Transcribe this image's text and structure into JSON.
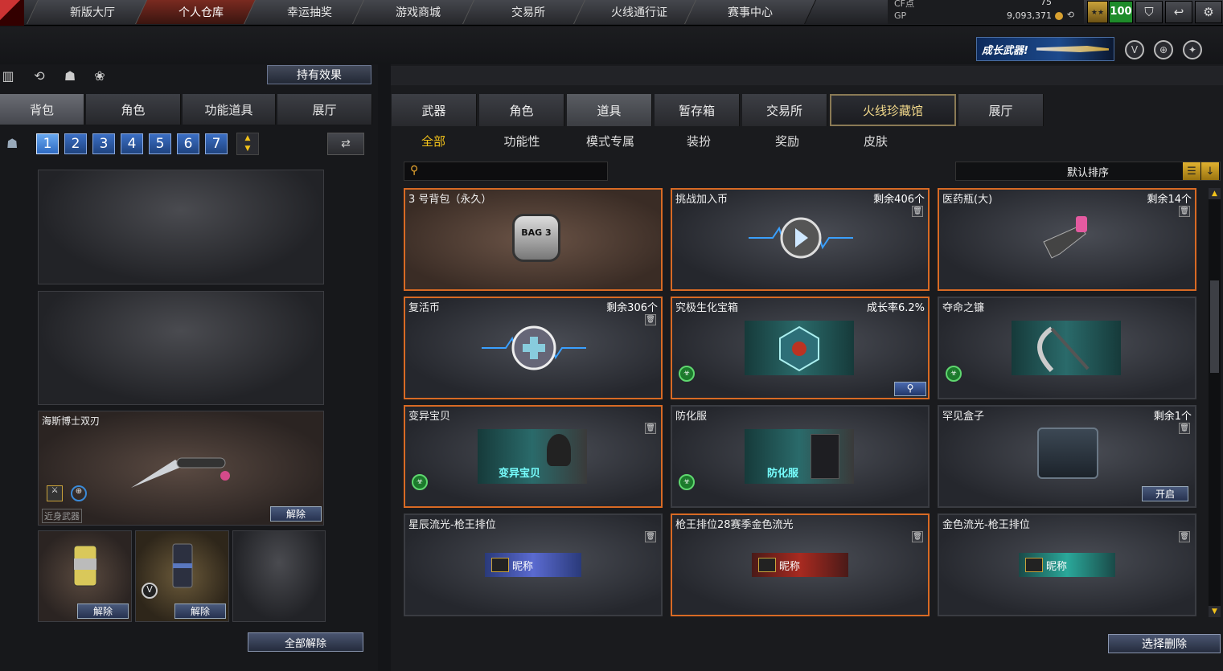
{
  "nav": {
    "tabs": [
      "新版大厅",
      "个人仓库",
      "幸运抽奖",
      "游戏商城",
      "交易所",
      "火线通行证",
      "赛事中心"
    ],
    "active": 1
  },
  "currency": {
    "cf_label": "CF点",
    "cf_value": "75",
    "gp_label": "GP",
    "gp_value": "9,093,371"
  },
  "level": "100",
  "grow_banner": "成长武器!",
  "left": {
    "effect_button": "持有效果",
    "tabs": [
      "背包",
      "角色",
      "功能道具",
      "展厅"
    ],
    "pages": [
      "1",
      "2",
      "3",
      "4",
      "5",
      "6",
      "7"
    ],
    "active_page": "1",
    "equipped_item": "海斯博士双刃",
    "equipped_type": "近身武器",
    "unequip": "解除",
    "unequip_all": "全部解除"
  },
  "right": {
    "tabs": [
      "武器",
      "角色",
      "道具",
      "暂存箱",
      "交易所",
      "火线珍藏馆",
      "展厅"
    ],
    "active_tab": "道具",
    "subtabs": [
      "全部",
      "功能性",
      "模式专属",
      "装扮",
      "奖励",
      "皮肤"
    ],
    "active_subtab": "全部",
    "sort": "默认排序",
    "delete_button": "选择删除",
    "items": [
      {
        "name": "3 号背包（永久）",
        "remaining": "",
        "art": "BAG 3"
      },
      {
        "name": "挑战加入币",
        "remaining": "剩余406个"
      },
      {
        "name": "医药瓶(大)",
        "remaining": "剩余14个"
      },
      {
        "name": "复活币",
        "remaining": "剩余306个"
      },
      {
        "name": "究极生化宝箱",
        "remaining": "成长率6.2%"
      },
      {
        "name": "夺命之镰",
        "remaining": ""
      },
      {
        "name": "变异宝贝",
        "remaining": "",
        "art": "变异宝贝"
      },
      {
        "name": "防化服",
        "remaining": "",
        "art": "防化服"
      },
      {
        "name": "罕见盒子",
        "remaining": "剩余1个",
        "open": "开启"
      },
      {
        "name": "星辰流光-枪王排位",
        "remaining": "",
        "nick": "昵称"
      },
      {
        "name": "枪王排位28赛季金色流光",
        "remaining": "",
        "nick": "昵称"
      },
      {
        "name": "金色流光-枪王排位",
        "remaining": "",
        "nick": "昵称"
      }
    ]
  },
  "colors": {
    "accent": "#f2c21a",
    "selected_border": "#d86a24",
    "button_blue": "#2e6ac2"
  }
}
